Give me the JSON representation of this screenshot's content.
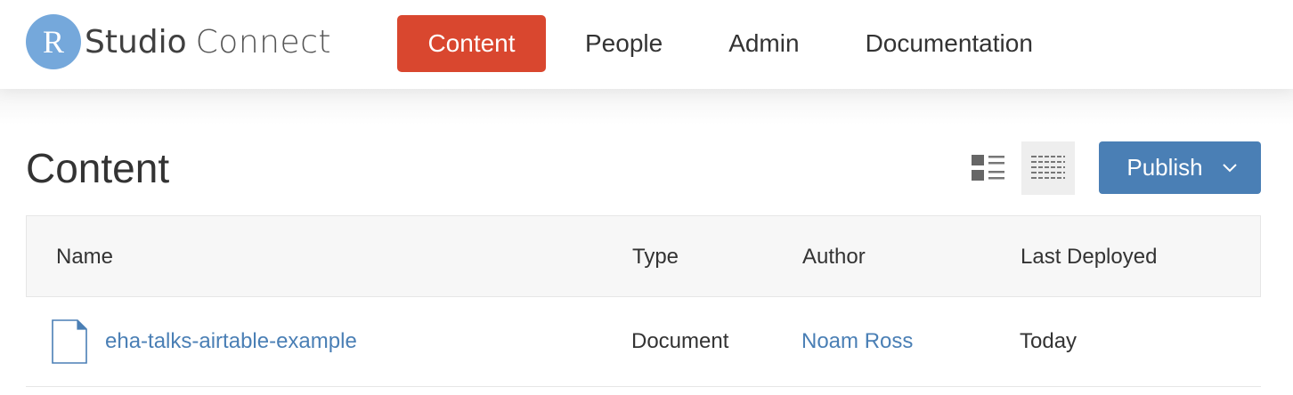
{
  "app": {
    "logo_letter": "R",
    "logo_studio": "Studio",
    "logo_connect": "Connect"
  },
  "nav": {
    "items": [
      {
        "label": "Content",
        "active": true
      },
      {
        "label": "People",
        "active": false
      },
      {
        "label": "Admin",
        "active": false
      },
      {
        "label": "Documentation",
        "active": false
      }
    ]
  },
  "page": {
    "title": "Content",
    "publish_label": "Publish",
    "view_modes": [
      "list-view-icon",
      "table-view-icon"
    ],
    "active_view": "table-view-icon"
  },
  "table": {
    "columns": [
      "Name",
      "Type",
      "Author",
      "Last Deployed"
    ],
    "rows": [
      {
        "icon": "document-icon",
        "name": "eha-talks-airtable-example",
        "type": "Document",
        "author": "Noam Ross",
        "last_deployed": "Today"
      }
    ]
  },
  "colors": {
    "accent_active": "#d9472f",
    "primary_button": "#4a7fb5",
    "link": "#4a7fb5",
    "logo_circle": "#75a8db"
  }
}
